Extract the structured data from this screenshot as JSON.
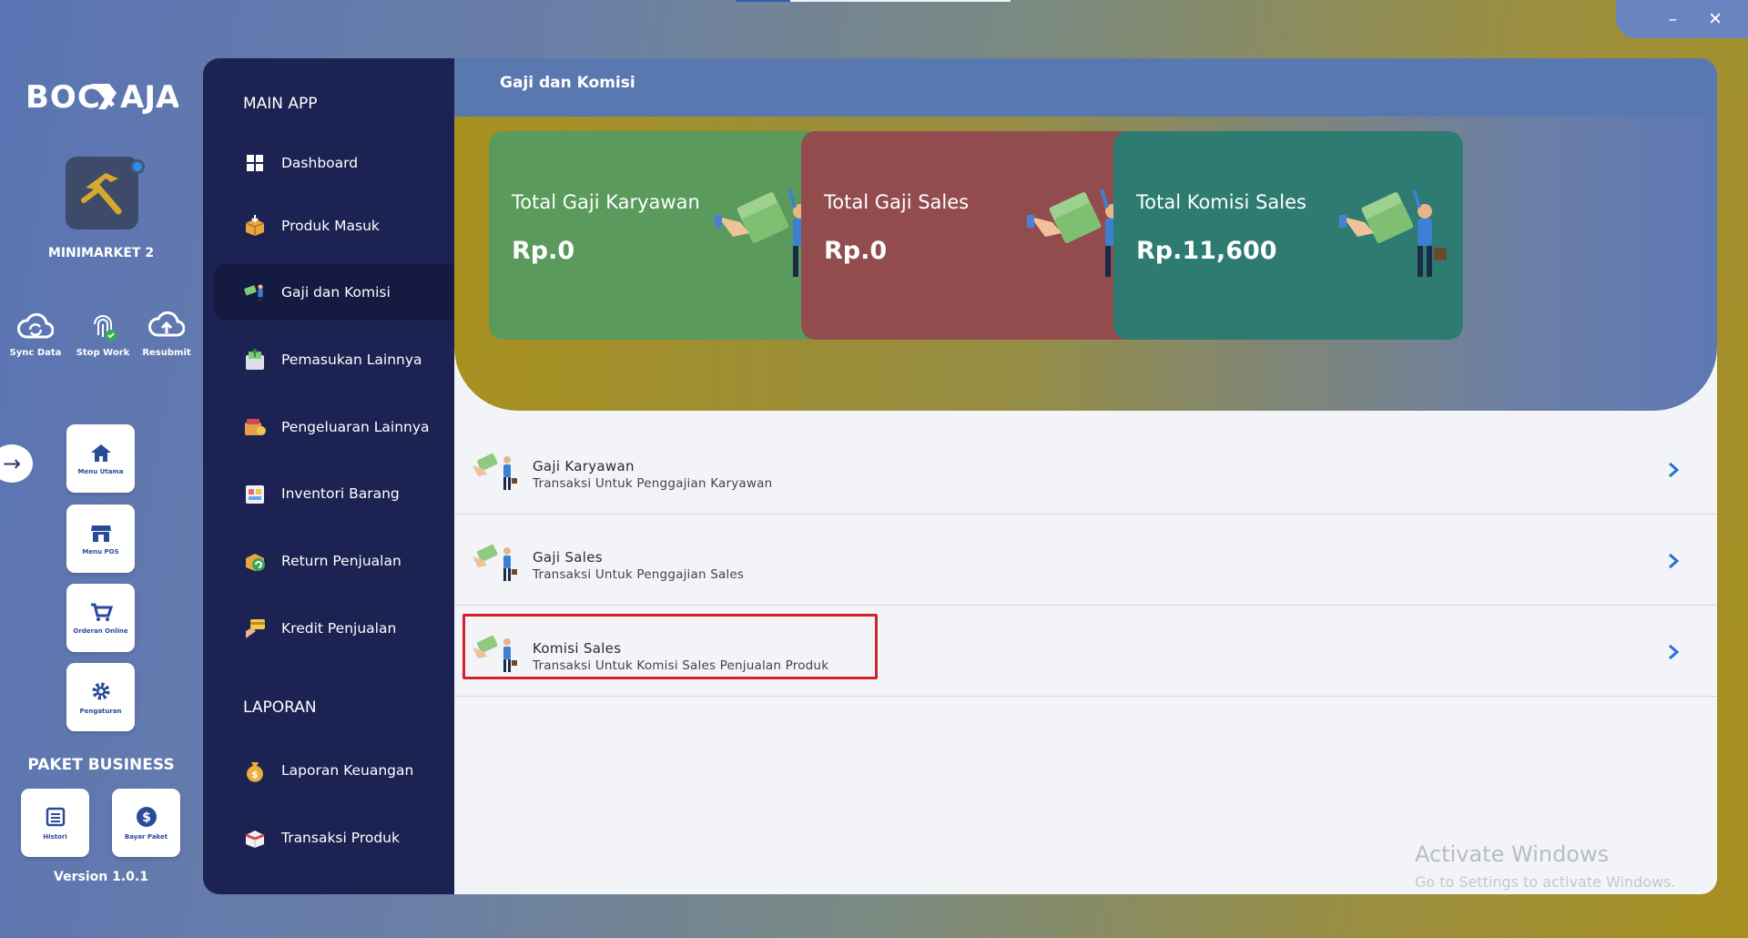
{
  "window_controls": {
    "minimize": "–",
    "close": "✕"
  },
  "rail": {
    "logo_text": "BOC AJA",
    "store_name": "MINIMARKET 2",
    "quick_actions": [
      {
        "label": "Sync Data",
        "icon": "sync-cloud-icon"
      },
      {
        "label": "Stop Work",
        "icon": "fingerprint-icon"
      },
      {
        "label": "Resubmit",
        "icon": "upload-cloud-icon"
      }
    ],
    "tiles": [
      {
        "label": "Menu Utama",
        "icon": "home-icon"
      },
      {
        "label": "Menu POS",
        "icon": "store-icon"
      },
      {
        "label": "Orderan Online",
        "icon": "cart-icon"
      },
      {
        "label": "Pengaturan",
        "icon": "gear-icon"
      }
    ],
    "paket_title": "PAKET BUSINESS",
    "paket_tiles": [
      {
        "label": "Histori",
        "icon": "list-icon"
      },
      {
        "label": "Bayar Paket",
        "icon": "dollar-icon"
      }
    ],
    "version": "Version 1.0.1"
  },
  "sidebar": {
    "main_title": "MAIN APP",
    "main_items": [
      {
        "label": "Dashboard",
        "icon": "dashboard-icon",
        "active": false
      },
      {
        "label": "Produk Masuk",
        "icon": "box-in-icon",
        "active": false
      },
      {
        "label": "Gaji dan Komisi",
        "icon": "salary-icon",
        "active": true
      },
      {
        "label": "Pemasukan Lainnya",
        "icon": "income-icon",
        "active": false
      },
      {
        "label": "Pengeluaran Lainnya",
        "icon": "expense-icon",
        "active": false
      },
      {
        "label": "Inventori Barang",
        "icon": "inventory-icon",
        "active": false
      },
      {
        "label": "Return Penjualan",
        "icon": "return-icon",
        "active": false
      },
      {
        "label": "Kredit Penjualan",
        "icon": "credit-icon",
        "active": false
      }
    ],
    "report_title": "LAPORAN",
    "report_items": [
      {
        "label": "Laporan Keuangan",
        "icon": "money-bag-icon"
      },
      {
        "label": "Transaksi Produk",
        "icon": "product-box-icon"
      }
    ]
  },
  "page": {
    "header": "Gaji dan Komisi",
    "cards": [
      {
        "title": "Total Gaji Karyawan",
        "value": "Rp.0",
        "color": "#5a9a5c"
      },
      {
        "title": "Total Gaji Sales",
        "value": "Rp.0",
        "color": "#924c4e"
      },
      {
        "title": "Total Komisi Sales",
        "value": "Rp.11,600",
        "color": "#2e7b72"
      }
    ],
    "rows": [
      {
        "title": "Gaji Karyawan",
        "subtitle": "Transaksi Untuk Penggajian Karyawan"
      },
      {
        "title": "Gaji Sales",
        "subtitle": "Transaksi Untuk Penggajian Sales"
      },
      {
        "title": "Komisi Sales",
        "subtitle": "Transaksi Untuk Komisi Sales Penjualan Produk"
      }
    ]
  },
  "watermark": {
    "line1": "Activate Windows",
    "line2": "Go to Settings to activate Windows."
  },
  "colors": {
    "sidebar_bg": "#1c2251",
    "highlight_border": "#d4202a",
    "chevron": "#2a6fd6"
  }
}
